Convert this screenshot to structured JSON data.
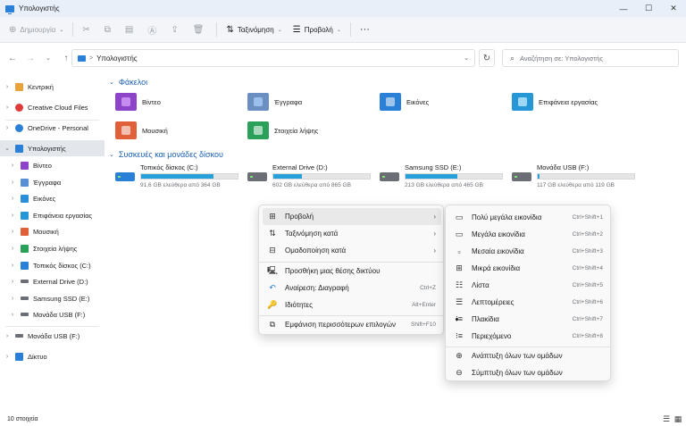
{
  "window": {
    "title": "Υπολογιστής"
  },
  "window_controls": {
    "minimize": "—",
    "maximize": "☐",
    "close": "✕"
  },
  "commandbar": {
    "new_label": "Δημιουργία",
    "sort_label": "Ταξινόμηση",
    "view_label": "Προβολή",
    "more": "···"
  },
  "address": {
    "location": "Υπολογιστής",
    "separator": ">"
  },
  "search": {
    "placeholder": "Αναζήτηση σε: Υπολογιστής"
  },
  "sidebar": {
    "items": [
      {
        "label": "Κεντρική",
        "color": "#e8a33d"
      },
      {
        "label": "Creative Cloud Files",
        "color": "#e03a3a"
      },
      {
        "label": "OneDrive - Personal",
        "color": "#2a7fd6"
      },
      {
        "label": "Υπολογιστής",
        "color": "#2a7fd6"
      },
      {
        "label": "Βίντεο",
        "color": "#8e44c9"
      },
      {
        "label": "Έγγραφα",
        "color": "#5a8fd6"
      },
      {
        "label": "Εικόνες",
        "color": "#2a8fd6"
      },
      {
        "label": "Επιφάνεια εργασίας",
        "color": "#2596d6"
      },
      {
        "label": "Μουσική",
        "color": "#e0603a"
      },
      {
        "label": "Στοιχεία λήψης",
        "color": "#2aa05a"
      },
      {
        "label": "Τοπικός δίσκος (C:)",
        "color": "#6b6f75"
      },
      {
        "label": "External Drive (D:)",
        "color": "#6b6f75"
      },
      {
        "label": "Samsung SSD (E:)",
        "color": "#6b6f75"
      },
      {
        "label": "Μονάδα USB (F:)",
        "color": "#6b6f75"
      },
      {
        "label": "Μονάδα USB (F:)",
        "color": "#6b6f75"
      },
      {
        "label": "Δίκτυο",
        "color": "#2a7fd6"
      }
    ]
  },
  "content": {
    "folders_header": "Φάκελοι",
    "folders": [
      {
        "label": "Βίντεο",
        "color": "#8e44c9",
        "accent": "#c58df0"
      },
      {
        "label": "Έγγραφα",
        "color": "#6a8fc0",
        "accent": "#9cc0ec"
      },
      {
        "label": "Εικόνες",
        "color": "#2a7fd6",
        "accent": "#ffffff"
      },
      {
        "label": "Επιφάνεια εργασίας",
        "color": "#2596d6",
        "accent": "#9fd8f4"
      },
      {
        "label": "Μουσική",
        "color": "#e0603a",
        "accent": "#ffffff"
      },
      {
        "label": "Στοιχεία λήψης",
        "color": "#2aa05a",
        "accent": "#ffffff"
      }
    ],
    "drives_header": "Συσκευές και μονάδες δίσκου",
    "drives": [
      {
        "name": "Τοπικός δίσκος (C:)",
        "free": "91,6 GB ελεύθερα από 364 GB",
        "used_fraction": 0.75
      },
      {
        "name": "External Drive (D:)",
        "free": "602 GB ελεύθερα από 865 GB",
        "used_fraction": 0.3
      },
      {
        "name": "Samsung SSD (E:)",
        "free": "213 GB ελεύθερα από 465 GB",
        "used_fraction": 0.54
      },
      {
        "name": "Μονάδα USB (F:)",
        "free": "117 GB ελεύθερα από 119 GB",
        "used_fraction": 0.02
      }
    ]
  },
  "context_menu": {
    "items": [
      {
        "label": "Προβολή",
        "icon": "grid-icon",
        "shortcut": ""
      },
      {
        "label": "Ταξινόμηση κατά",
        "icon": "sort-icon",
        "shortcut": ""
      },
      {
        "label": "Ομαδοποίηση κατά",
        "icon": "group-icon",
        "shortcut": ""
      },
      {
        "label": "Προσθήκη μιας θέσης δικτύου",
        "icon": "network-location-icon",
        "shortcut": ""
      },
      {
        "label": "Αναίρεση: Διαγραφή",
        "icon": "undo-icon",
        "shortcut": "Ctrl+Z"
      },
      {
        "label": "Ιδιότητες",
        "icon": "properties-icon",
        "shortcut": "Alt+Enter"
      },
      {
        "label": "Εμφάνιση περισσότερων επιλογών",
        "icon": "more-options-icon",
        "shortcut": "Shift+F10"
      }
    ]
  },
  "view_submenu": {
    "items": [
      {
        "label": "Πολύ μεγάλα εικονίδια",
        "shortcut": "Ctrl+Shift+1"
      },
      {
        "label": "Μεγάλα εικονίδια",
        "shortcut": "Ctrl+Shift+2"
      },
      {
        "label": "Μεσαία εικονίδια",
        "shortcut": "Ctrl+Shift+3"
      },
      {
        "label": "Μικρά εικονίδια",
        "shortcut": "Ctrl+Shift+4"
      },
      {
        "label": "Λίστα",
        "shortcut": "Ctrl+Shift+5"
      },
      {
        "label": "Λεπτομέρειες",
        "shortcut": "Ctrl+Shift+6"
      },
      {
        "label": "Πλακίδια",
        "shortcut": "Ctrl+Shift+7"
      },
      {
        "label": "Περιεχόμενο",
        "shortcut": "Ctrl+Shift+8"
      },
      {
        "label": "Ανάπτυξη όλων των ομάδων",
        "shortcut": ""
      },
      {
        "label": "Σύμπτυξη όλων των ομάδων",
        "shortcut": ""
      }
    ]
  },
  "status": {
    "count": "10 στοιχεία"
  }
}
